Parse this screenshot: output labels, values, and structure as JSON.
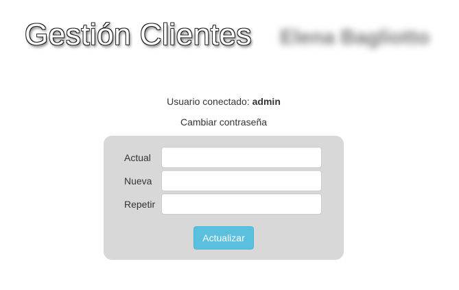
{
  "header": {
    "title": "Gestión Clientes",
    "owner_name_blurred": "Elena Bagliotto"
  },
  "session": {
    "prefix": "Usuario conectado:",
    "username": "admin"
  },
  "form": {
    "title": "Cambiar contraseña",
    "fields": [
      {
        "label": "Actual",
        "value": ""
      },
      {
        "label": "Nueva",
        "value": ""
      },
      {
        "label": "Repetir",
        "value": ""
      }
    ],
    "submit_label": "Actualizar"
  },
  "colors": {
    "panel_bg": "#d8d8d8",
    "button_bg": "#5bc0de",
    "button_text": "#ffffff"
  }
}
